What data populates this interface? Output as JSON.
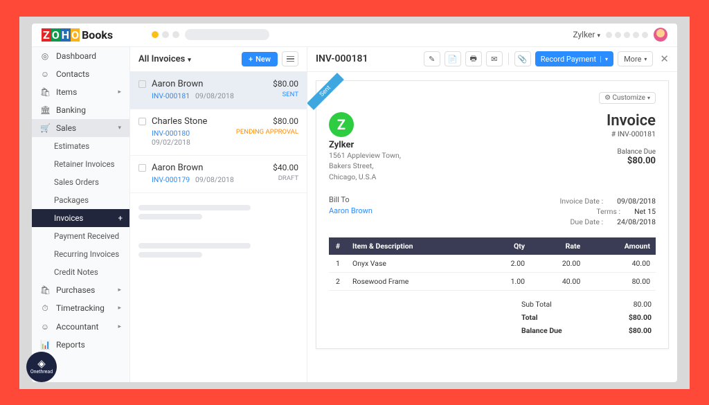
{
  "topbar": {
    "org_name": "Zylker"
  },
  "sidebar": {
    "items": [
      {
        "icon": "◎",
        "label": "Dashboard"
      },
      {
        "icon": "☺",
        "label": "Contacts"
      },
      {
        "icon": "🛍",
        "label": "Items",
        "expandable": true
      },
      {
        "icon": "🏛",
        "label": "Banking"
      },
      {
        "icon": "🛒",
        "label": "Sales",
        "expandable": true,
        "active": true
      },
      {
        "icon": "🛍",
        "label": "Purchases",
        "expandable": true
      },
      {
        "icon": "⏱",
        "label": "Timetracking",
        "expandable": true
      },
      {
        "icon": "☺",
        "label": "Accountant",
        "expandable": true
      },
      {
        "icon": "📊",
        "label": "Reports"
      }
    ],
    "sales_sub": [
      "Estimates",
      "Retainer Invoices",
      "Sales Orders",
      "Packages",
      "Invoices",
      "Payment Received",
      "Recurring Invoices",
      "Credit Notes"
    ]
  },
  "list": {
    "title": "All Invoices",
    "new_label": "New",
    "rows": [
      {
        "name": "Aaron Brown",
        "inv": "INV-000181",
        "date": "09/08/2018",
        "amount": "$80.00",
        "status": "SENT",
        "status_cls": "stat-sent",
        "sel": true
      },
      {
        "name": "Charles Stone",
        "inv": "INV-000180",
        "date": "09/02/2018",
        "amount": "$80.00",
        "status": "PENDING APPROVAL",
        "status_cls": "stat-pend"
      },
      {
        "name": "Aaron Brown",
        "inv": "INV-000179",
        "date": "09/08/2018",
        "amount": "$40.00",
        "status": "DRAFT",
        "status_cls": "stat-draft"
      }
    ]
  },
  "detail": {
    "title": "INV-000181",
    "record_payment": "Record Payment",
    "more": "More",
    "customize": "Customize",
    "ribbon": "Sent",
    "company": {
      "name": "Zylker",
      "addr1": "1561 Appleview Town,",
      "addr2": "Bakers Street,",
      "addr3": "Chicago, U.S.A"
    },
    "doc_title": "Invoice",
    "doc_num": "# INV-000181",
    "balance_label": "Balance Due",
    "balance": "$80.00",
    "billto_label": "Bill To",
    "billto_name": "Aaron Brown",
    "meta": [
      {
        "k": "Invoice Date :",
        "v": "09/08/2018"
      },
      {
        "k": "Terms :",
        "v": "Net 15"
      },
      {
        "k": "Due Date :",
        "v": "24/08/2018"
      }
    ],
    "cols": [
      "#",
      "Item & Description",
      "Qty",
      "Rate",
      "Amount"
    ],
    "items": [
      {
        "n": "1",
        "desc": "Onyx Vase",
        "qty": "2.00",
        "rate": "20.00",
        "amt": "40.00"
      },
      {
        "n": "2",
        "desc": "Rosewood Frame",
        "qty": "1.00",
        "rate": "40.00",
        "amt": "80.00"
      }
    ],
    "totals": [
      {
        "k": "Sub Total",
        "v": "80.00"
      },
      {
        "k": "Total",
        "v": "$80.00",
        "bold": true
      },
      {
        "k": "Balance Due",
        "v": "$80.00",
        "bold": true
      }
    ]
  },
  "watermark": "Onethread"
}
